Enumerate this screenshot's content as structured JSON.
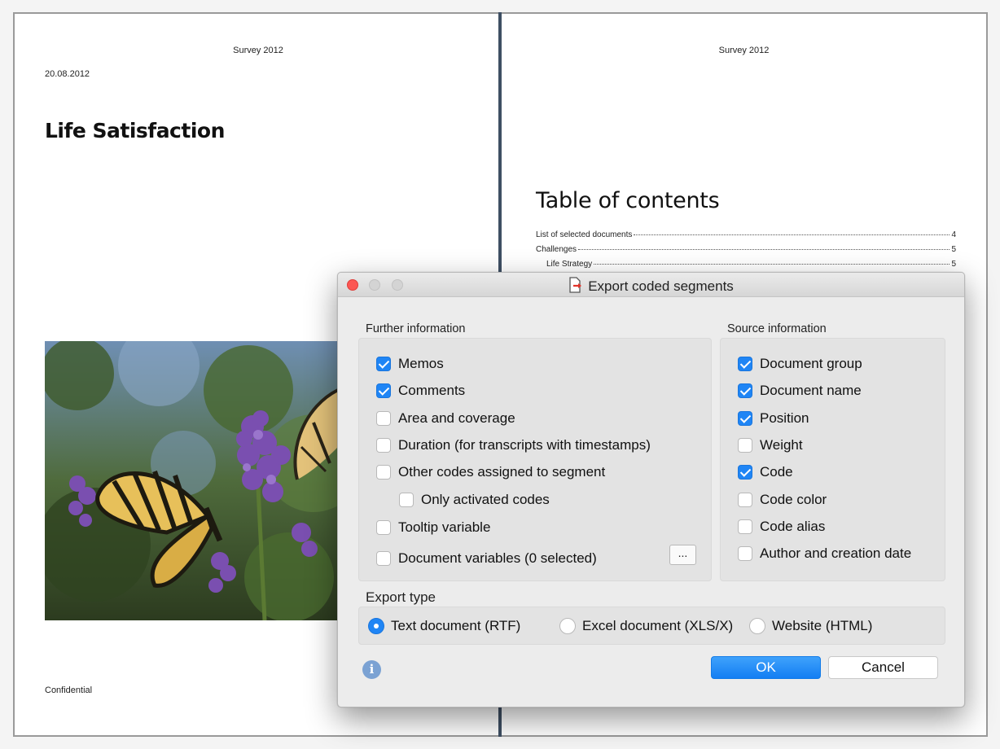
{
  "document": {
    "left_page": {
      "header": "Survey 2012",
      "date": "20.08.2012",
      "title": "Life Satisfaction",
      "footer": "Confidential"
    },
    "right_page": {
      "header": "Survey 2012",
      "toc_title": "Table of contents",
      "toc_entries": [
        {
          "title": "List of selected documents",
          "page": "4"
        },
        {
          "title": "Challenges",
          "page": "5"
        },
        {
          "title": "Life Strategy",
          "page": "5"
        }
      ]
    },
    "colors": {
      "spine": "#3e4f63"
    }
  },
  "dialog": {
    "title": "Export coded segments",
    "title_icon": "export-document-icon",
    "further_information": {
      "label": "Further information",
      "options": [
        {
          "label": "Memos",
          "checked": true
        },
        {
          "label": "Comments",
          "checked": true
        },
        {
          "label": "Area and coverage",
          "checked": false
        },
        {
          "label": "Duration (for transcripts with timestamps)",
          "checked": false
        },
        {
          "label": "Other codes assigned to segment",
          "checked": false
        },
        {
          "label": "Only activated codes",
          "checked": false
        },
        {
          "label": "Tooltip variable",
          "checked": false
        },
        {
          "label": "Document variables (0 selected)",
          "checked": false
        }
      ],
      "more_button": "..."
    },
    "source_information": {
      "label": "Source information",
      "options": [
        {
          "label": "Document group",
          "checked": true
        },
        {
          "label": "Document name",
          "checked": true
        },
        {
          "label": "Position",
          "checked": true
        },
        {
          "label": "Weight",
          "checked": false
        },
        {
          "label": "Code",
          "checked": true
        },
        {
          "label": "Code color",
          "checked": false
        },
        {
          "label": "Code alias",
          "checked": false
        },
        {
          "label": "Author and creation date",
          "checked": false
        }
      ]
    },
    "export_type": {
      "label": "Export type",
      "options": [
        {
          "label": "Text document (RTF)",
          "selected": true
        },
        {
          "label": "Excel document (XLS/X)",
          "selected": false
        },
        {
          "label": "Website (HTML)",
          "selected": false
        }
      ]
    },
    "buttons": {
      "ok": "OK",
      "cancel": "Cancel"
    },
    "info_icon": "i",
    "colors": {
      "accent": "#1f85f5",
      "close": "#fc5753"
    }
  }
}
